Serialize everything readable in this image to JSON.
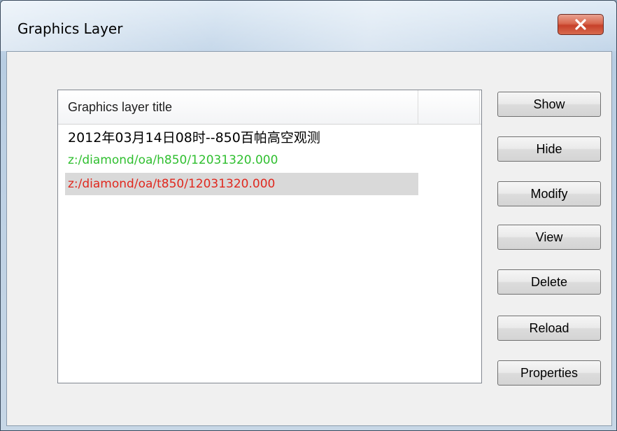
{
  "window": {
    "title": "Graphics Layer",
    "close_label": "X"
  },
  "listview": {
    "columns": [
      "Graphics layer title",
      ""
    ],
    "rows": [
      {
        "text": "2012年03月14日08时--850百帕高空观测",
        "color": "#000000"
      },
      {
        "text": "z:/diamond/oa/h850/12031320.000",
        "color": "#2fbf2f"
      },
      {
        "text": "z:/diamond/oa/t850/12031320.000",
        "color": "#e0281e"
      }
    ],
    "selected_row": 2
  },
  "buttons": {
    "show": "Show",
    "hide": "Hide",
    "modify": "Modify",
    "view": "View",
    "delete": "Delete",
    "reload": "Reload",
    "properties": "Properties"
  },
  "colors": {
    "selection": "#d9d9d9",
    "close_button": "#c7412a"
  }
}
